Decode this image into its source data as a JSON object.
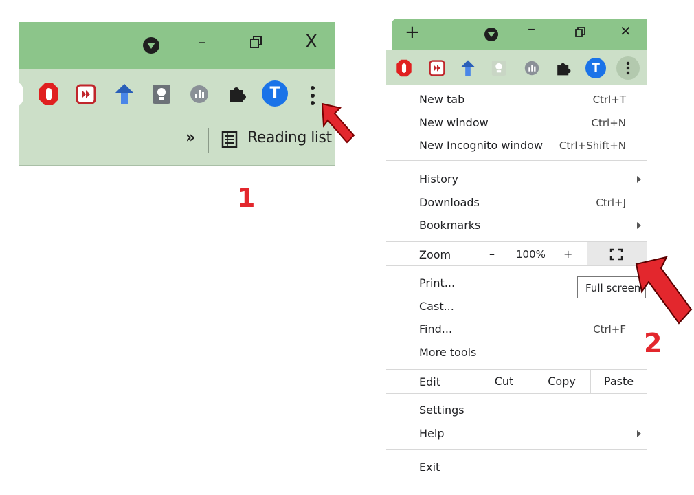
{
  "panel1": {
    "window_controls": {
      "minimize": "–",
      "restore": "◻",
      "close": "X"
    },
    "profile_initial": "T",
    "more_chevron": "»",
    "reading_list_label": "Reading list",
    "step_number": "1"
  },
  "panel2": {
    "new_tab_symbol": "+",
    "window_controls": {
      "minimize": "–",
      "restore": "◻",
      "close": "✕"
    },
    "profile_initial": "T",
    "menu": {
      "new_tab": {
        "label": "New tab",
        "shortcut": "Ctrl+T"
      },
      "new_window": {
        "label": "New window",
        "shortcut": "Ctrl+N"
      },
      "new_incognito": {
        "label": "New Incognito window",
        "shortcut": "Ctrl+Shift+N"
      },
      "history": {
        "label": "History"
      },
      "downloads": {
        "label": "Downloads",
        "shortcut": "Ctrl+J"
      },
      "bookmarks": {
        "label": "Bookmarks"
      },
      "zoom": {
        "label": "Zoom",
        "minus": "–",
        "value": "100%",
        "plus": "+"
      },
      "print": {
        "label": "Print..."
      },
      "cast": {
        "label": "Cast..."
      },
      "find": {
        "label": "Find...",
        "shortcut": "Ctrl+F"
      },
      "more_tools": {
        "label": "More tools"
      },
      "edit": {
        "label": "Edit",
        "cut": "Cut",
        "copy": "Copy",
        "paste": "Paste"
      },
      "settings": {
        "label": "Settings"
      },
      "help": {
        "label": "Help"
      },
      "exit": {
        "label": "Exit"
      }
    },
    "tooltip": "Full screen",
    "step_number": "2"
  },
  "colors": {
    "titlebar": "#8cc58a",
    "toolbar": "#ccdfc8",
    "arrow": "#e3272d",
    "profile": "#1a73e8"
  },
  "icons": [
    "vpn-icon",
    "adblock-icon",
    "video-speed-icon",
    "upload-arrow-icon",
    "bulb-icon",
    "stats-icon",
    "puzzle-extensions-icon",
    "kebab-menu-icon",
    "reading-list-icon",
    "fullscreen-icon",
    "red-arrow-icon"
  ]
}
